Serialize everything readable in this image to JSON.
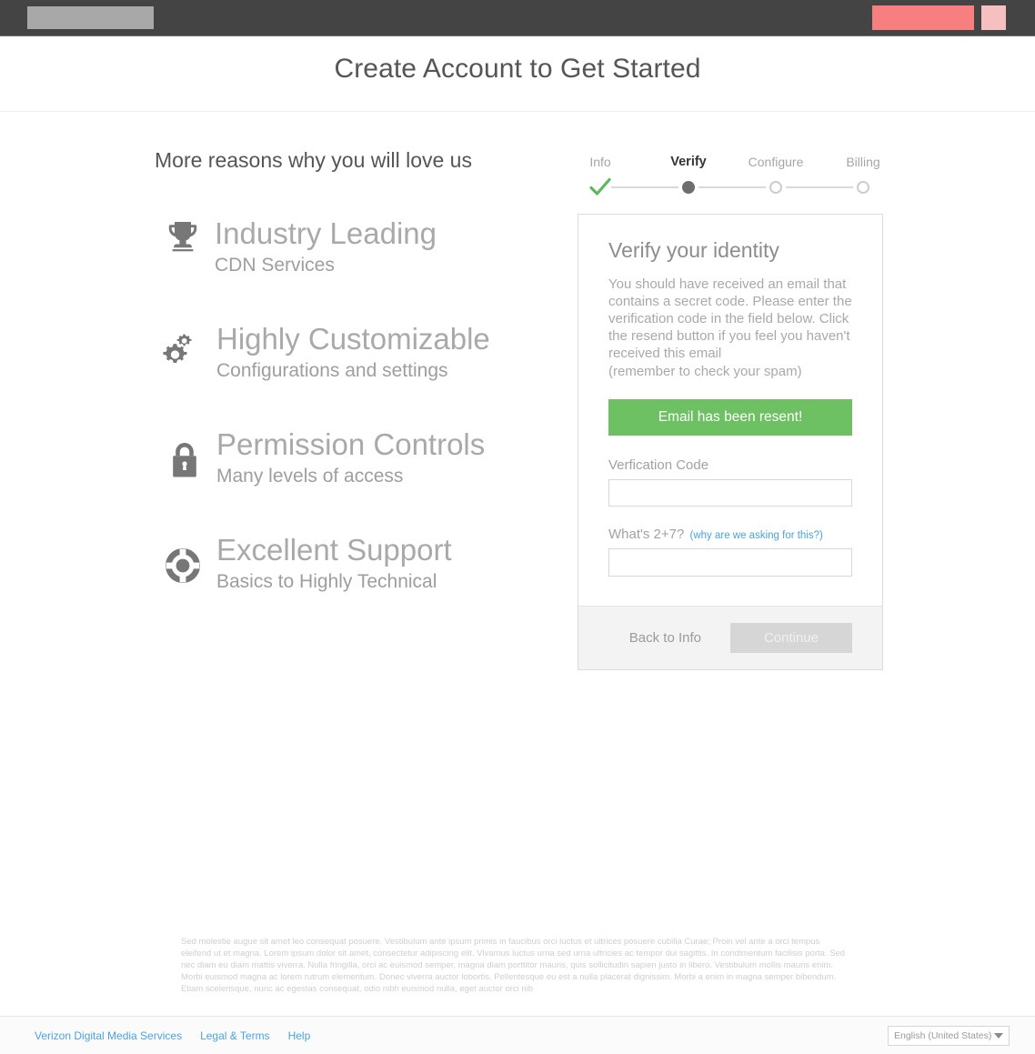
{
  "topbar": {
    "logo_placeholder": "",
    "primary_button_label": "",
    "secondary_button_label": "",
    "background_color": "#444444",
    "primary_button_color": "#f77f7f",
    "secondary_button_color": "#f6c0c0",
    "logo_color": "#a8a8a8"
  },
  "header": {
    "title": "Create Account to Get Started"
  },
  "features": {
    "heading": "More reasons why you will love us",
    "items": [
      {
        "icon": "trophy-icon",
        "title": "Industry Leading",
        "subtitle": "CDN Services"
      },
      {
        "icon": "gears-icon",
        "title": "Highly Customizable",
        "subtitle": "Configurations and settings"
      },
      {
        "icon": "lock-icon",
        "title": "Permission Controls",
        "subtitle": "Many levels of access"
      },
      {
        "icon": "lifebuoy-icon",
        "title": "Excellent Support",
        "subtitle": "Basics to Highly Technical"
      }
    ]
  },
  "stepper": {
    "steps": [
      {
        "label": "Info",
        "state": "done"
      },
      {
        "label": "Verify",
        "state": "current"
      },
      {
        "label": "Configure",
        "state": "todo"
      },
      {
        "label": "Billing",
        "state": "todo"
      }
    ],
    "done_color": "#5cb85c",
    "current_color": "#6d6d6d",
    "todo_color": "#cdcdcd"
  },
  "card": {
    "title": "Verify your identity",
    "description": "You should have received an email that contains a secret code. Please enter the verification code in the field below. Click the resend button if you feel you haven't received this email",
    "description_note": "(remember to check your spam)",
    "resend_button_label": "Email has been resent!",
    "resend_button_color": "#6dc163",
    "verification_label": "Verfication Code",
    "verification_value": "",
    "verification_placeholder": "",
    "captcha_question": "What's 2+7?",
    "captcha_why_link": "(why are we asking for this?)",
    "captcha_value": "",
    "captcha_placeholder": "",
    "back_button_label": "Back to Info",
    "continue_button_label": "Continue"
  },
  "legal": {
    "text": "Sed molestie augue sit amet leo consequat posuere. Vestibulum ante ipsum primis in faucibus orci luctus et ultrices posuere cubilia Curae; Proin vel ante a orci tempus eleifend ut et magna. Lorem ipsum dolor sit amet, consectetur adipiscing elit. Vivamus luctus urna sed urna ultricies ac tempor dui sagittis. In condimentum facilisis porta. Sed nec diam eu diam mattis viverra. Nulla fringilla, orci ac euismod semper, magna diam porttitor mauris, quis sollicitudin sapien justo in libero. Vestibulum mollis mauris enim. Morbi euismod magna ac lorem rutrum elementum. Donec viverra auctor lobortis. Pellentesque eu est a nulla placerat dignissim. Morbi a enim in magna semper bibendum. Etiam scelerisque, nunc ac egestas consequat, odio nibh euismod nulla, eget auctor orci nib"
  },
  "footer": {
    "links": [
      {
        "label": "Verizon Digital Media Services"
      },
      {
        "label": "Legal & Terms"
      },
      {
        "label": "Help"
      }
    ],
    "link_color": "#4aa3df",
    "language": "English (United States)"
  }
}
